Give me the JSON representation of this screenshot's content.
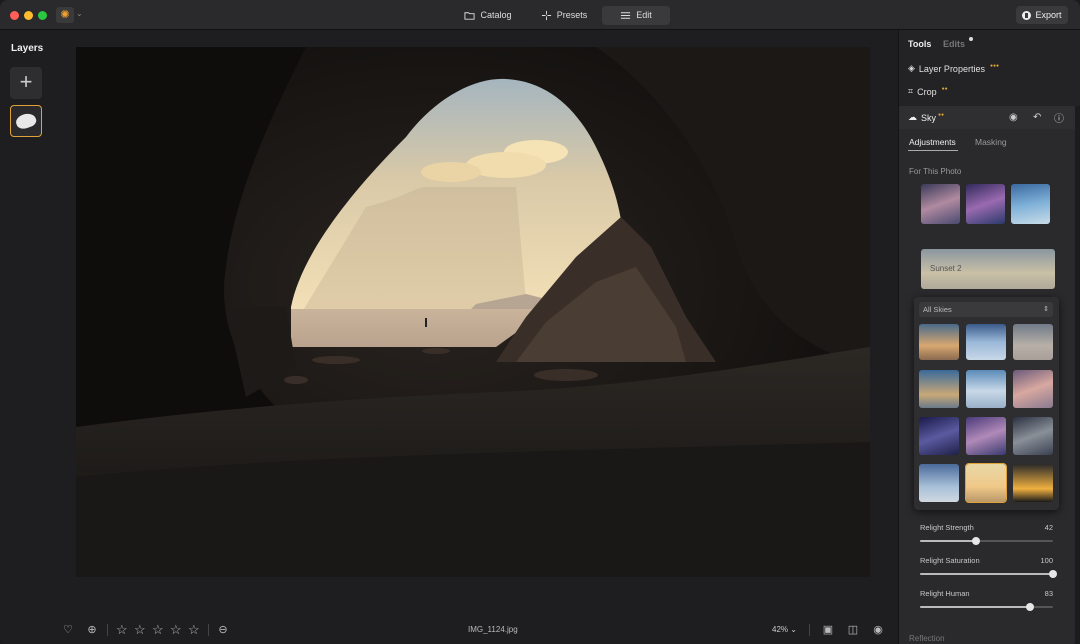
{
  "window": {
    "controls": [
      "close",
      "minimize",
      "zoom"
    ],
    "logo_icon": "sun-icon"
  },
  "header": {
    "tabs": [
      {
        "label": "Catalog",
        "icon": "folder-icon",
        "active": false
      },
      {
        "label": "Presets",
        "icon": "sparkle-icon",
        "active": false
      },
      {
        "label": "Edit",
        "icon": "sliders-icon",
        "active": true
      }
    ],
    "export_label": "Export"
  },
  "layers": {
    "title": "Layers",
    "add_label": "+"
  },
  "photo": {
    "filename": "IMG_1124.jpg",
    "zoom": "42%"
  },
  "bottom": {
    "rating_stars": 5
  },
  "tools": {
    "tab_tools": "Tools",
    "tab_edits": "Edits",
    "layer_properties": "Layer Properties",
    "crop": "Crop",
    "sky": {
      "title": "Sky",
      "subtabs": [
        "Adjustments",
        "Masking"
      ],
      "for_this_photo": "For This Photo",
      "selected_sky": "Sunset 2",
      "category": "All Skies",
      "sliders": [
        {
          "label": "Relight Strength",
          "value": 42
        },
        {
          "label": "Relight Saturation",
          "value": 100
        },
        {
          "label": "Relight Human",
          "value": 83
        }
      ],
      "next_section": "Reflection"
    }
  },
  "colors": {
    "accent": "#e0a33a",
    "panel": "#2a2a2c",
    "background": "#1e1e20"
  }
}
